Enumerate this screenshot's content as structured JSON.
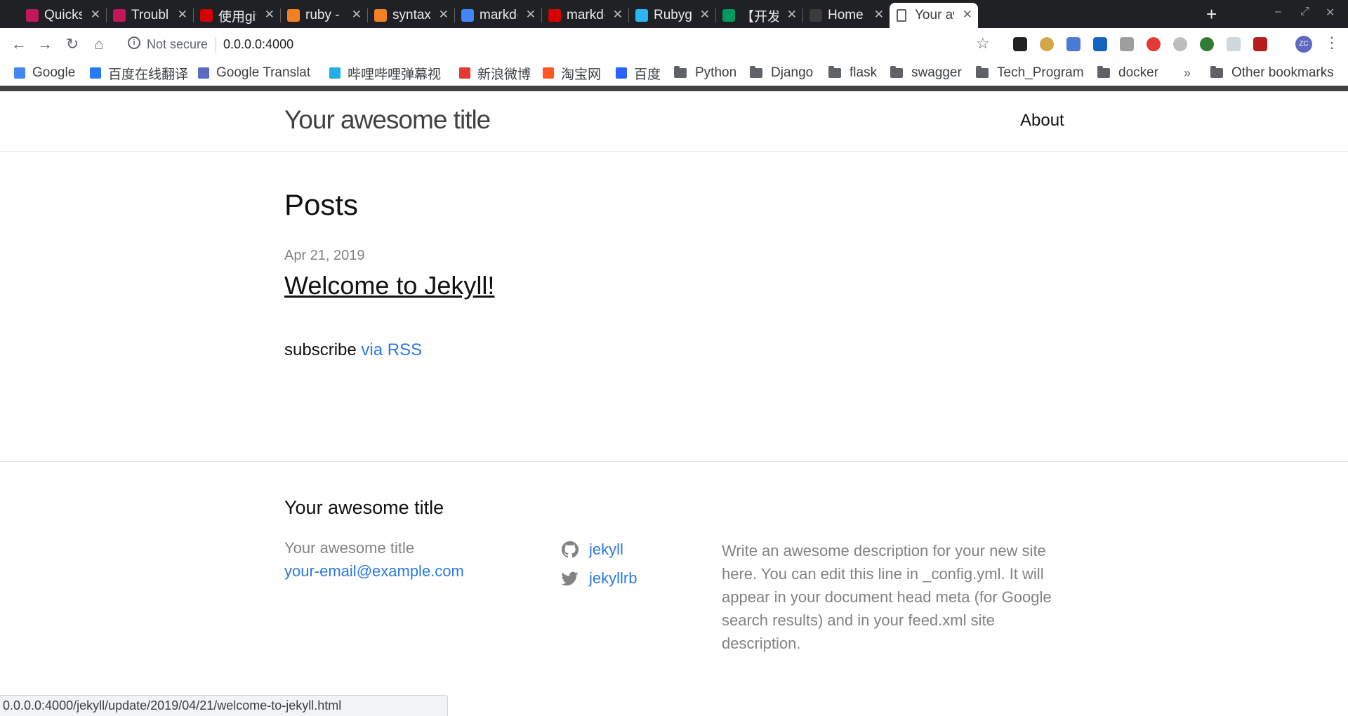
{
  "browser": {
    "tabs": [
      {
        "title": "Quicksta",
        "icon": "jekyll-icon",
        "color": "#c2185b"
      },
      {
        "title": "Troubles",
        "icon": "jekyll-icon",
        "color": "#c2185b"
      },
      {
        "title": "使用githu",
        "icon": "csdn-icon",
        "color": "#d50000"
      },
      {
        "title": "ruby - Ra",
        "icon": "stackoverflow-icon",
        "color": "#f48024"
      },
      {
        "title": "syntax - ",
        "icon": "stackoverflow-icon",
        "color": "#f48024"
      },
      {
        "title": "markdov",
        "icon": "google-icon",
        "color": "#4285f4"
      },
      {
        "title": "markdov",
        "icon": "csdn-icon",
        "color": "#d50000"
      },
      {
        "title": "Rubygen",
        "icon": "rubygems-icon",
        "color": "#29b6f6"
      },
      {
        "title": "【开发笔",
        "icon": "segmentfault-icon",
        "color": "#009a61"
      },
      {
        "title": "Home – ",
        "icon": "github-icon",
        "color": "#3c3c3c"
      },
      {
        "title": "Your awe",
        "icon": "page-icon",
        "color": "#ffffff",
        "active": true
      }
    ],
    "new_tab": "+",
    "window_controls": {
      "minimize": "–",
      "restore": "⤢",
      "close": "✕"
    },
    "toolbar": {
      "back": "←",
      "forward": "→",
      "reload": "↻",
      "home": "⌂",
      "security_label": "Not secure",
      "url": "0.0.0.0:4000",
      "star": "☆",
      "profile_initials": "ZC",
      "menu": "⋮"
    },
    "bookmarks": [
      {
        "label": "Google",
        "type": "site",
        "color": "#4285f4"
      },
      {
        "label": "百度在线翻译",
        "type": "site",
        "color": "#2979ff"
      },
      {
        "label": "Google Translat",
        "type": "site",
        "color": "#5c6bc0"
      },
      {
        "label": "哔哩哔哩弹幕视",
        "type": "site",
        "color": "#23ade5"
      },
      {
        "label": "新浪微博",
        "type": "site",
        "color": "#e53935"
      },
      {
        "label": "淘宝网",
        "type": "site",
        "color": "#ff5722"
      },
      {
        "label": "百度",
        "type": "site",
        "color": "#2962ff"
      },
      {
        "label": "Python",
        "type": "folder"
      },
      {
        "label": "Django",
        "type": "folder"
      },
      {
        "label": "flask",
        "type": "folder"
      },
      {
        "label": "swagger",
        "type": "folder"
      },
      {
        "label": "Tech_Program",
        "type": "folder"
      },
      {
        "label": "docker",
        "type": "folder"
      }
    ],
    "more_bookmarks": "»",
    "other_bookmarks": "Other bookmarks",
    "status_url": "0.0.0.0:4000/jekyll/update/2019/04/21/welcome-to-jekyll.html"
  },
  "site": {
    "title": "Your awesome title",
    "nav": {
      "about": "About"
    }
  },
  "main": {
    "heading": "Posts",
    "posts": [
      {
        "date": "Apr 21, 2019",
        "title": "Welcome to Jekyll!"
      }
    ],
    "subscribe_text": "subscribe ",
    "rss_link": "via RSS"
  },
  "footer": {
    "heading": "Your awesome title",
    "name": "Your awesome title",
    "email": "your-email@example.com",
    "github": "jekyll",
    "twitter": "jekyllrb",
    "description": "Write an awesome description for your new site here. You can edit this line in _config.yml. It will appear in your document head meta (for Google search results) and in your feed.xml site description."
  },
  "colors": {
    "link": "#2a7ae2",
    "muted": "#828282",
    "tabbar": "#202124"
  }
}
